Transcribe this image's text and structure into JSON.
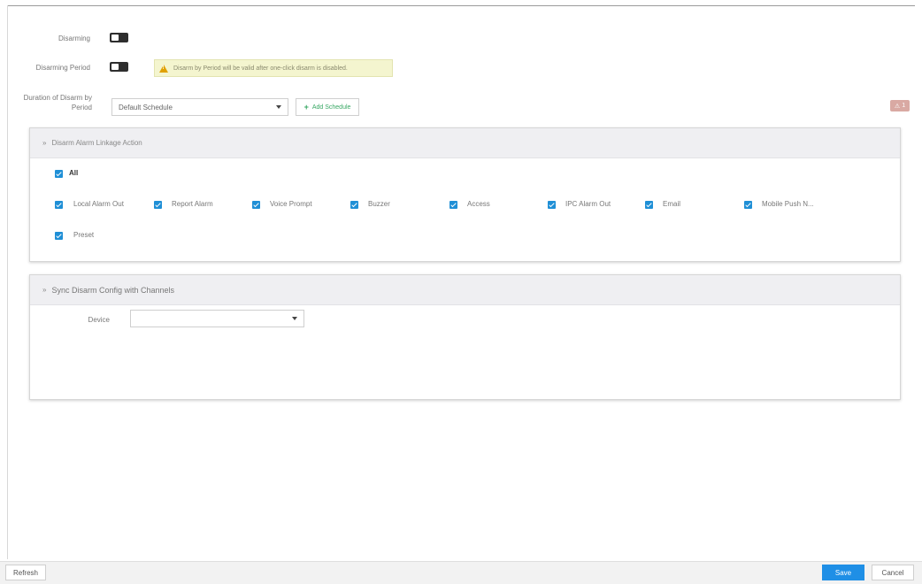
{
  "form": {
    "disarming_label": "Disarming",
    "disarming_period_label": "Disarming Period",
    "warning_text": "Disarm by Period will be valid after one-click disarm is disabled.",
    "duration_label": "Duration of Disarm by Period",
    "schedule_value": "Default Schedule",
    "add_schedule_label": "Add Schedule",
    "corner_badge_text": "1"
  },
  "linkage": {
    "title": "Disarm Alarm Linkage Action",
    "all_label": "All",
    "items": [
      {
        "label": "Local Alarm Out",
        "checked": true
      },
      {
        "label": "Report Alarm",
        "checked": true
      },
      {
        "label": "Voice Prompt",
        "checked": true
      },
      {
        "label": "Buzzer",
        "checked": true
      },
      {
        "label": "Access",
        "checked": true
      },
      {
        "label": "IPC Alarm Out",
        "checked": true
      },
      {
        "label": "Email",
        "checked": true
      },
      {
        "label": "Mobile Push N...",
        "checked": true
      },
      {
        "label": "Preset",
        "checked": true
      }
    ]
  },
  "sync": {
    "title": "Sync Disarm Config with Channels",
    "device_label": "Device",
    "device_value": ""
  },
  "footer": {
    "refresh_label": "Refresh",
    "save_label": "Save",
    "cancel_label": "Cancel"
  },
  "colors": {
    "accent": "#1f8fe6",
    "checkbox": "#1f8fd6",
    "warning_bg": "#f4f5cf",
    "add_schedule": "#38a864"
  },
  "icons": {
    "warning": "warning-icon",
    "plus": "plus-icon",
    "chevron": "chevron-right-icon",
    "caret": "caret-down-icon"
  }
}
